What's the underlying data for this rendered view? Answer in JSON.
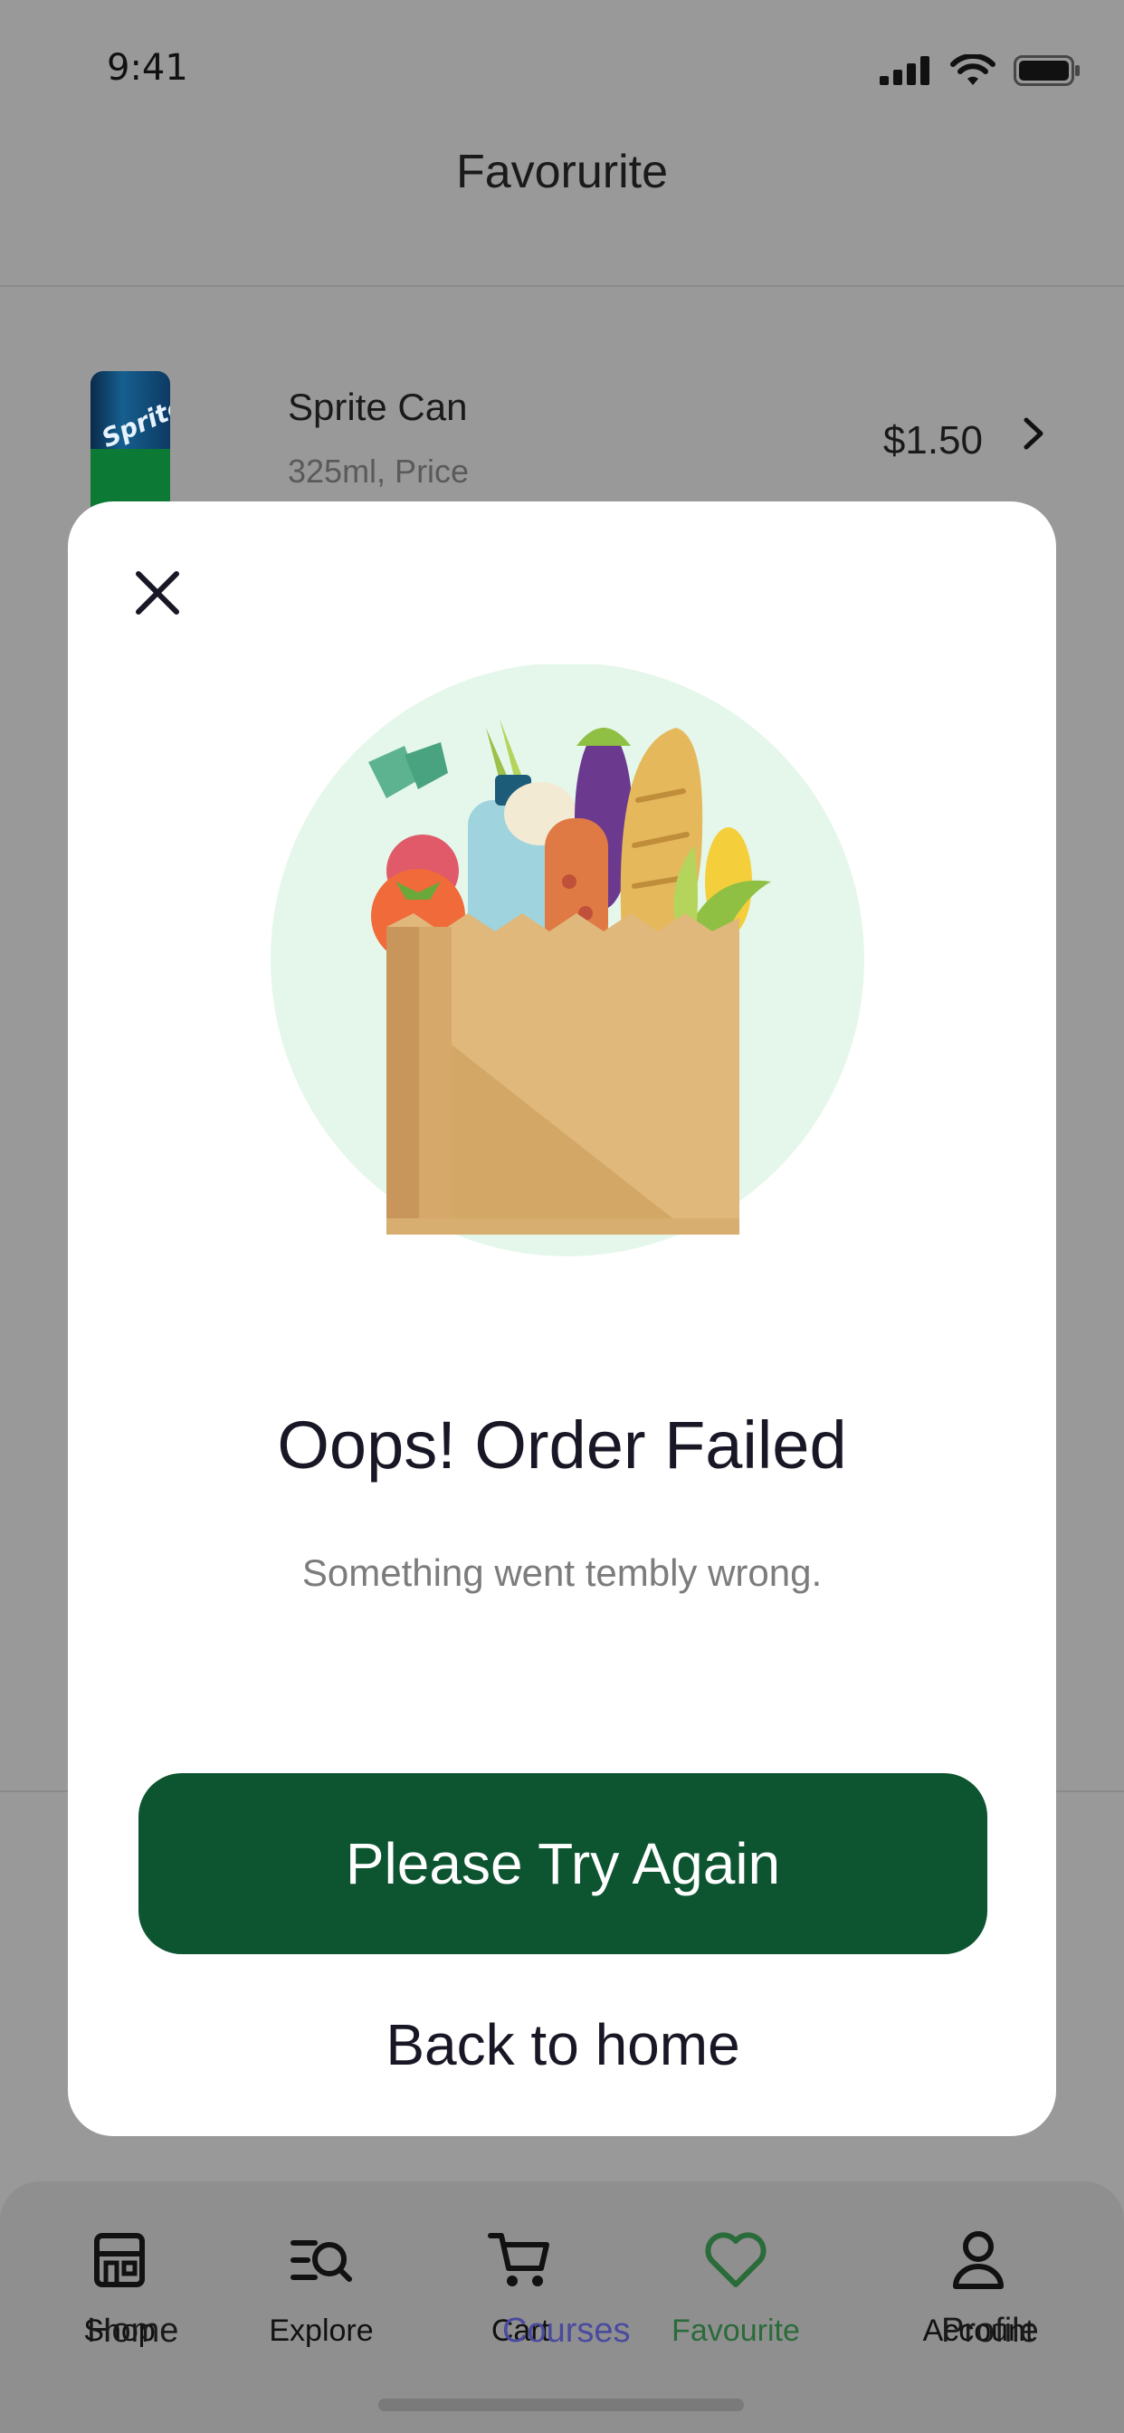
{
  "status_bar": {
    "time": "9:41"
  },
  "header": {
    "title": "Favorurite"
  },
  "favourite_item": {
    "name": "Sprite Can",
    "description": "325ml, Price",
    "price": "$1.50",
    "image_label": "Sprite"
  },
  "modal": {
    "title": "Oops! Order Failed",
    "message": "Something went tembly wrong.",
    "primary_button": "Please Try Again",
    "secondary_button": "Back to home",
    "accent_color": "#0D5530"
  },
  "tabbar": {
    "items": [
      {
        "label": "Shop",
        "icon": "store-icon"
      },
      {
        "label": "Explore",
        "icon": "explore-search-icon"
      },
      {
        "label": "Cart",
        "icon": "cart-icon"
      },
      {
        "label": "Favourite",
        "icon": "heart-icon",
        "active": true
      },
      {
        "label": "Account",
        "icon": "user-icon"
      }
    ],
    "ghost_labels": [
      "Home",
      "Courses",
      "Profile"
    ]
  }
}
